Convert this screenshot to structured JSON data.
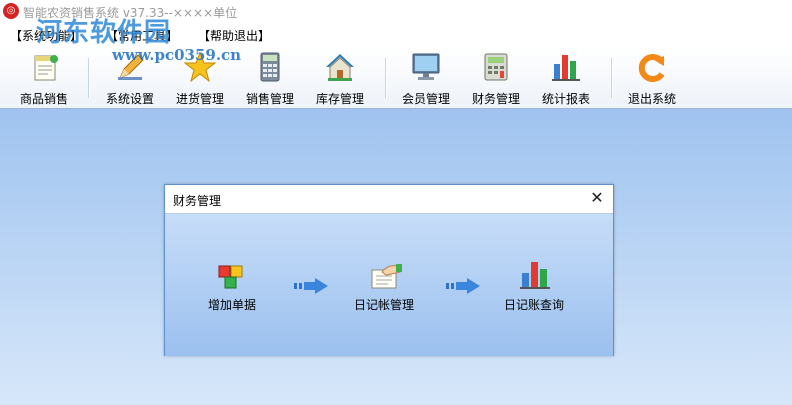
{
  "window": {
    "title": "智能农资销售系统 v37.33--××××单位",
    "watermark": "河东软件园",
    "watermark_url": "www.pc0359.cn"
  },
  "menu": [
    {
      "label": "【系统功能】"
    },
    {
      "label": "【常用工具】"
    },
    {
      "label": "【帮助退出】"
    }
  ],
  "toolbar": [
    {
      "label": "商品销售",
      "icon": "notepad-icon"
    },
    {
      "label": "系统设置",
      "icon": "pencil-icon"
    },
    {
      "label": "进货管理",
      "icon": "star-icon"
    },
    {
      "label": "销售管理",
      "icon": "calculator-icon"
    },
    {
      "label": "库存管理",
      "icon": "house-icon"
    },
    {
      "label": "会员管理",
      "icon": "monitor-icon"
    },
    {
      "label": "财务管理",
      "icon": "cash-register-icon"
    },
    {
      "label": "统计报表",
      "icon": "bar-chart-icon"
    },
    {
      "label": "退出系统",
      "icon": "exit-icon"
    }
  ],
  "dialog": {
    "title": "财务管理",
    "close": "✕",
    "flow": [
      {
        "label": "增加单据",
        "icon": "cubes-icon"
      },
      {
        "label": "日记帐管理",
        "icon": "hand-document-icon"
      },
      {
        "label": "日记账查询",
        "icon": "bar-chart-icon"
      }
    ]
  },
  "colors": {
    "accent": "#2f8ad8",
    "workspace_top": "#9fc3ef",
    "workspace_bottom": "#d7e7fa"
  }
}
